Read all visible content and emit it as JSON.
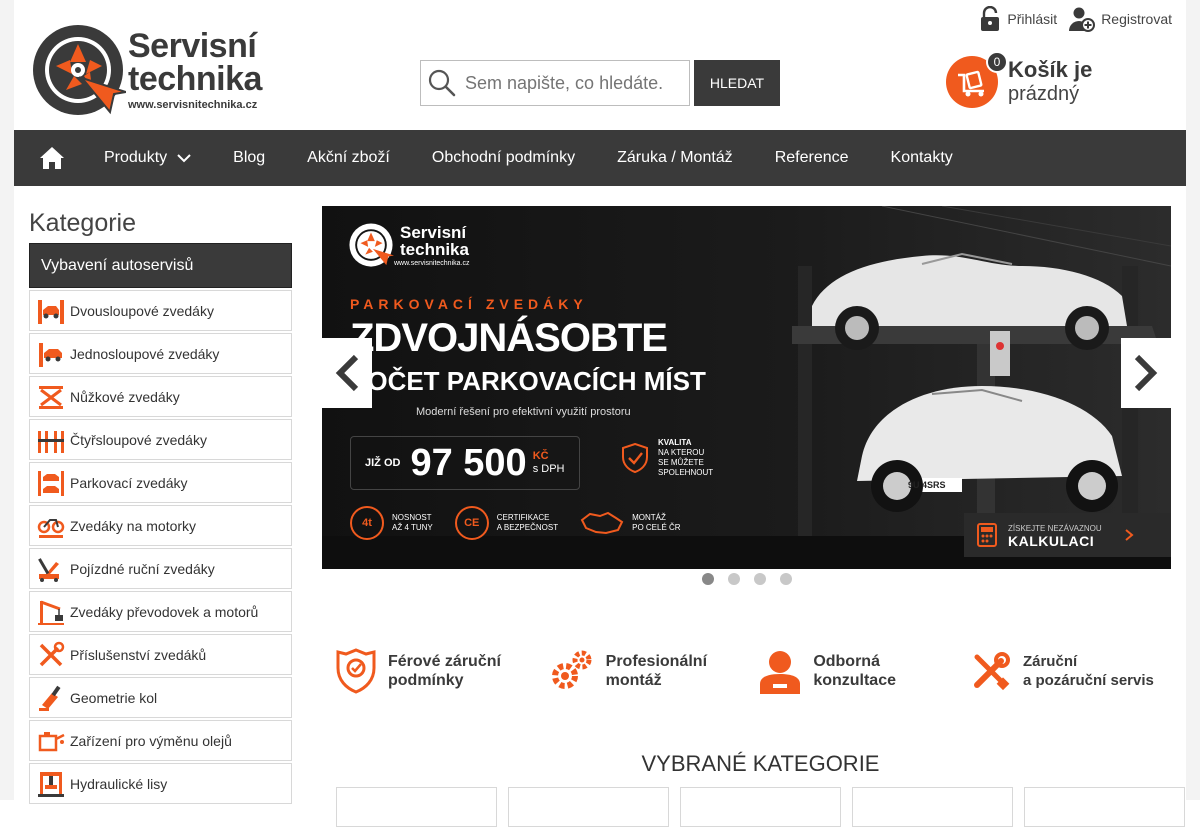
{
  "header": {
    "logo": {
      "line1": "Servisní",
      "line2": "technika",
      "url": "www.servisnitechnika.cz"
    },
    "search": {
      "placeholder": "Sem napište, co hledáte.",
      "button_label": "HLEDAT"
    },
    "top_links": {
      "login": "Přihlásit",
      "register": "Registrovat"
    },
    "cart": {
      "count": "0",
      "line1": "Košík je",
      "line2": "prázdný"
    }
  },
  "nav": {
    "items": [
      {
        "label": "Produkty"
      },
      {
        "label": "Blog"
      },
      {
        "label": "Akční zboží"
      },
      {
        "label": "Obchodní podmínky"
      },
      {
        "label": "Záruka / Montáž"
      },
      {
        "label": "Reference"
      },
      {
        "label": "Kontakty"
      }
    ]
  },
  "sidebar": {
    "title": "Kategorie",
    "header": "Vybavení autoservisů",
    "items": [
      {
        "label": "Dvousloupové zvedáky",
        "icon": "two-post-lift-icon"
      },
      {
        "label": "Jednosloupové zvedáky",
        "icon": "single-post-lift-icon"
      },
      {
        "label": "Nůžkové zvedáky",
        "icon": "scissor-lift-icon"
      },
      {
        "label": "Čtyřsloupové zvedáky",
        "icon": "four-post-lift-icon"
      },
      {
        "label": "Parkovací zvedáky",
        "icon": "parking-lift-icon"
      },
      {
        "label": "Zvedáky na motorky",
        "icon": "motorcycle-lift-icon"
      },
      {
        "label": "Pojízdné ruční zvedáky",
        "icon": "floor-jack-icon"
      },
      {
        "label": "Zvedáky převodovek a motorů",
        "icon": "engine-crane-icon"
      },
      {
        "label": "Příslušenství zvedáků",
        "icon": "tools-icon"
      },
      {
        "label": "Geometrie kol",
        "icon": "wheel-alignment-icon"
      },
      {
        "label": "Zařízení pro výměnu olejů",
        "icon": "oil-change-icon"
      },
      {
        "label": "Hydraulické lisy",
        "icon": "hydraulic-press-icon"
      }
    ]
  },
  "banner": {
    "logo_line1": "Servisní",
    "logo_line2": "technika",
    "logo_url": "www.servisnitechnika.cz",
    "kicker": "PARKOVACÍ ZVEDÁKY",
    "headline1": "ZDVOJNÁSOBTE",
    "headline2": "POČET PARKOVACÍCH MÍST",
    "subline": "Moderní řešení pro efektivní využití prostoru",
    "price_prefix": "JIŽ OD",
    "price": "97 500",
    "price_currency": "KČ",
    "price_vat": "s DPH",
    "quality_title": "KVALITA",
    "quality_line1": "NA KTEROU",
    "quality_line2": "SE MŮŽETE",
    "quality_line3": "SPOLEHNOUT",
    "feature1_icon": "4t",
    "feature1_line1": "NOSNOST",
    "feature1_line2": "AŽ 4 TUNY",
    "feature2_icon": "CE",
    "feature2_line1": "CERTIFIKACE",
    "feature2_line2": "A BEZPEČNOST",
    "feature3_line1": "MONTÁŽ",
    "feature3_line2": "PO CELÉ ČR",
    "cta_line1": "ZÍSKEJTE NEZÁVAZNOU",
    "cta_line2": "KALKULACI",
    "plate": "9U 4SRS",
    "active_slide": 1,
    "slide_count": 4
  },
  "usp": [
    {
      "line1": "Férové záruční",
      "line2": "podmínky",
      "icon": "shield-check-icon"
    },
    {
      "line1": "Profesionální",
      "line2": "montáž",
      "icon": "gears-icon"
    },
    {
      "line1": "Odborná",
      "line2": "konzultace",
      "icon": "consultant-icon"
    },
    {
      "line1": "Záruční",
      "line2": "a pozáruční servis",
      "icon": "wrench-screwdriver-icon"
    }
  ],
  "selected_categories": {
    "title": "VYBRANÉ KATEGORIE"
  },
  "colors": {
    "accent": "#f05a1e",
    "dark": "#3a3a3a",
    "banner_bg": "#151515"
  }
}
